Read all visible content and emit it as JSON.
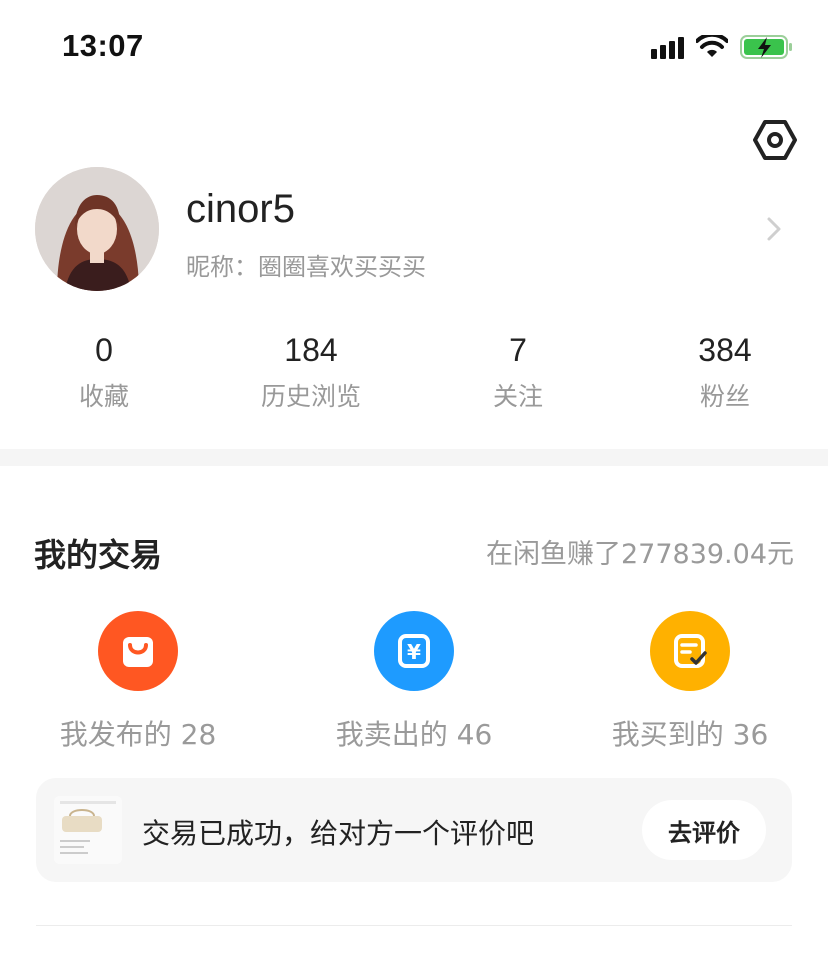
{
  "status_bar": {
    "time": "13:07"
  },
  "profile": {
    "username": "cinor5",
    "nickname": "昵称：圈圈喜欢买买买"
  },
  "stats": [
    {
      "value": "0",
      "label": "收藏"
    },
    {
      "value": "184",
      "label": "历史浏览"
    },
    {
      "value": "7",
      "label": "关注"
    },
    {
      "value": "384",
      "label": "粉丝"
    }
  ],
  "trade": {
    "title": "我的交易",
    "earned": "在闲鱼赚了277839.04元",
    "items": [
      {
        "label": "我发布的 28",
        "icon": "shopping-bag-icon",
        "color": "#ff5722"
      },
      {
        "label": "我卖出的 46",
        "icon": "yen-icon",
        "color": "#1e9bff"
      },
      {
        "label": "我买到的 36",
        "icon": "order-check-icon",
        "color": "#ffb100"
      }
    ]
  },
  "review": {
    "text": "交易已成功，给对方一个评价吧",
    "button": "去评价"
  }
}
